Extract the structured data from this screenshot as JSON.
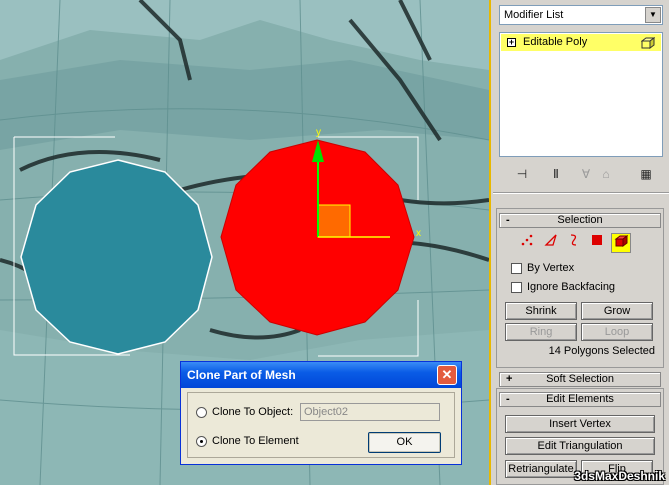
{
  "viewport": {
    "gizmo_label": "y",
    "gizmo_label_x": "x"
  },
  "panel": {
    "modifier_list": "Modifier List",
    "stack_item": "Editable Poly",
    "stack_tools": [
      "pin-stack-icon",
      "show-end-result-icon",
      "make-unique-icon",
      "remove-modifier-icon",
      "configure-modifier-sets-icon"
    ],
    "selection": {
      "title": "Selection",
      "by_vertex": "By Vertex",
      "ignore_backfacing": "Ignore Backfacing",
      "shrink": "Shrink",
      "grow": "Grow",
      "ring": "Ring",
      "loop": "Loop",
      "status": "14 Polygons Selected"
    },
    "soft_selection": {
      "title": "Soft Selection"
    },
    "edit_elements": {
      "title": "Edit Elements",
      "insert_vertex": "Insert Vertex",
      "edit_triangulation": "Edit Triangulation",
      "retriangulate": "Retriangulate",
      "flip": "Flip"
    }
  },
  "dialog": {
    "title": "Clone Part of Mesh",
    "clone_to_object": "Clone To Object:",
    "object_name": "Object02",
    "clone_to_element": "Clone To Element",
    "ok": "OK",
    "selected_option": "Clone To Element"
  },
  "watermark": "3dsMaxDeshnik",
  "colors": {
    "viewport_bg": "#7faaa8",
    "selected_poly": "#ff0000",
    "teal_poly": "#2a8a9c",
    "highlight": "#ffff66",
    "panel_bg": "#d6d3ce",
    "dialog_title": "#0a5ce6"
  }
}
